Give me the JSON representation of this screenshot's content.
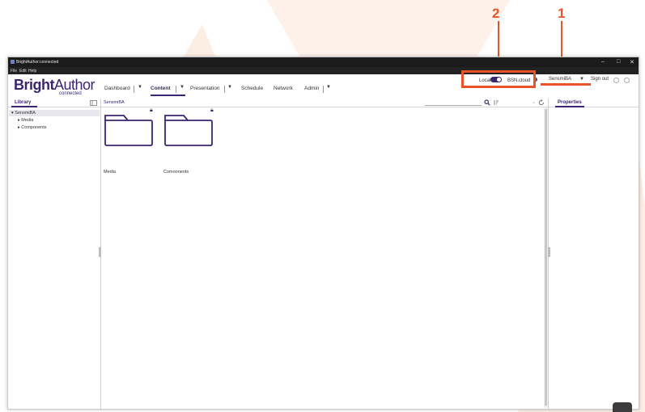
{
  "annotations": {
    "number_1": "1",
    "number_2": "2",
    "color": "#e8542a"
  },
  "window": {
    "title": "BrightAuthor:connected",
    "menu": [
      "File",
      "Edit",
      "Help"
    ],
    "controls": {
      "minimize": "–",
      "maximize": "□",
      "close": "✕"
    }
  },
  "header": {
    "logo_main_bold": "Bright",
    "logo_main_thin": "Author",
    "logo_sub": "connected",
    "nav": [
      {
        "label": "Dashboard",
        "has_menu": true
      },
      {
        "label": "Content",
        "has_menu": true,
        "active": true
      },
      {
        "label": "Presentation",
        "has_menu": true
      },
      {
        "label": "Schedule",
        "has_menu": false
      },
      {
        "label": "Network",
        "has_menu": false
      },
      {
        "label": "Admin",
        "has_menu": true
      }
    ],
    "mode_local": "Local",
    "mode_cloud": "BSN.cloud",
    "account": "SensmiBA",
    "sign_out": "Sign out",
    "brand_color": "#3a2570"
  },
  "library": {
    "title": "Library",
    "tree": [
      {
        "label": "SensmiBA",
        "expanded": true
      },
      {
        "label": "Media",
        "expanded": false
      },
      {
        "label": "Components",
        "expanded": false
      }
    ]
  },
  "content": {
    "breadcrumb": "SensmiBA",
    "folders": [
      {
        "label": "Media",
        "locked": true
      },
      {
        "label": "Comoonents",
        "locked": true
      }
    ]
  },
  "properties": {
    "title": "Properties"
  }
}
